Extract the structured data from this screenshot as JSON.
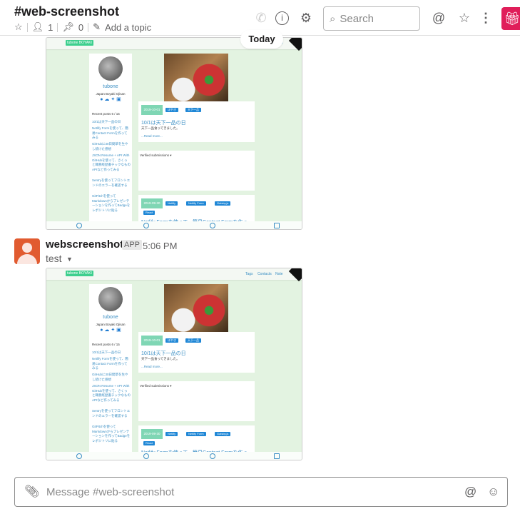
{
  "header": {
    "channel": "#web-screenshot",
    "members": "1",
    "pins": "0",
    "topic": "Add a topic",
    "search_placeholder": "Search"
  },
  "divider": {
    "label": "Today"
  },
  "message": {
    "user": "webscreenshot",
    "badge": "APP",
    "time": "5:06 PM",
    "text": "test"
  },
  "preview": {
    "brand": "tubone BOYAKI",
    "nav": [
      "Tags",
      "Contacts",
      "Note"
    ],
    "name": "tubone",
    "subtitle": "Japan Boyaki Ojisan",
    "recent": "Recent posts 6 / 15",
    "posts": [
      "10/1は天下一品の日",
      "Netlify Formを使って、簡易Contact Formを作ってみる",
      "GitHubに30日間草を生やし続けた感想",
      "JSON Resume + API With GitHubを使って、さくっと職務経歴書チックなものAPIなど作ってみる",
      "Sentryを使ってフロントエンドのエラーを確認する",
      "GitPitchを使ってMarkdownからプレゼンテーションを作ってBadgeをレポジトリに貼る"
    ],
    "post1": {
      "date": "2019-10-01",
      "tags": [
        "ぼやき",
        "天下一品"
      ],
      "title": "10/1は天下一品の日",
      "text": "天下一品食ってきました。",
      "more": "...Read more..."
    },
    "verified": "Verified submissions ▾",
    "post2": {
      "date": "2019-09-30",
      "tags": [
        "Netlify",
        "Netlify Form",
        "Gatsby.js",
        "React"
      ],
      "title": "Netlify Formを使って、簡易Contact Formを作っ"
    }
  },
  "composer": {
    "placeholder": "Message #web-screenshot"
  },
  "colors": {
    "gift": "#e01e5a",
    "avatar": "#e15b30"
  }
}
